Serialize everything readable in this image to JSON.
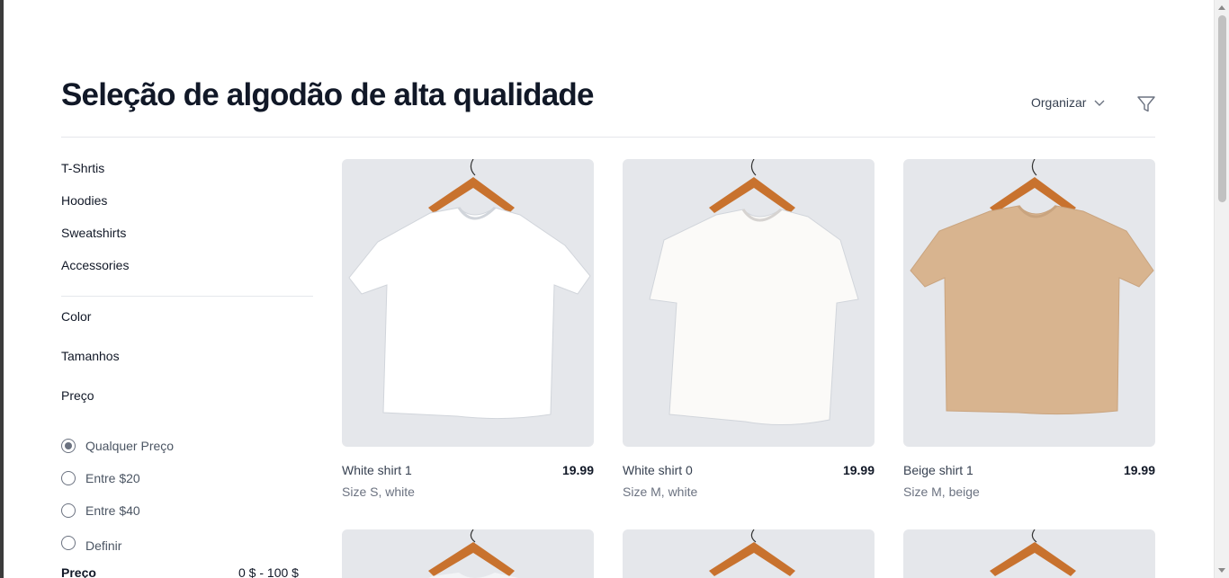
{
  "page": {
    "title": "Seleção de algodão de alta qualidade"
  },
  "toolbar": {
    "sort_label": "Organizar"
  },
  "sidebar": {
    "categories": [
      "T-Shrtis",
      "Hoodies",
      "Sweatshirts",
      "Accessories"
    ],
    "filters": [
      "Color",
      "Tamanhos",
      "Preço"
    ],
    "price_options": [
      {
        "label": "Qualquer Preço",
        "checked": true
      },
      {
        "label": "Entre $20",
        "checked": false
      },
      {
        "label": "Entre $40",
        "checked": false
      },
      {
        "label": "Definir",
        "checked": false
      }
    ],
    "price_label": "Preço",
    "price_range": "0 $ - 100 $"
  },
  "products": [
    {
      "name": "White shirt 1",
      "price": "19.99",
      "desc": "Size S, white",
      "color": "#ffffff"
    },
    {
      "name": "White shirt 0",
      "price": "19.99",
      "desc": "Size M, white",
      "color": "#fbfaf8"
    },
    {
      "name": "Beige shirt 1",
      "price": "19.99",
      "desc": "Size M, beige",
      "color": "#d8b48f"
    }
  ],
  "colors": {
    "accent": "#111827",
    "card_bg": "#e5e7eb",
    "hanger": "#c8722e"
  }
}
